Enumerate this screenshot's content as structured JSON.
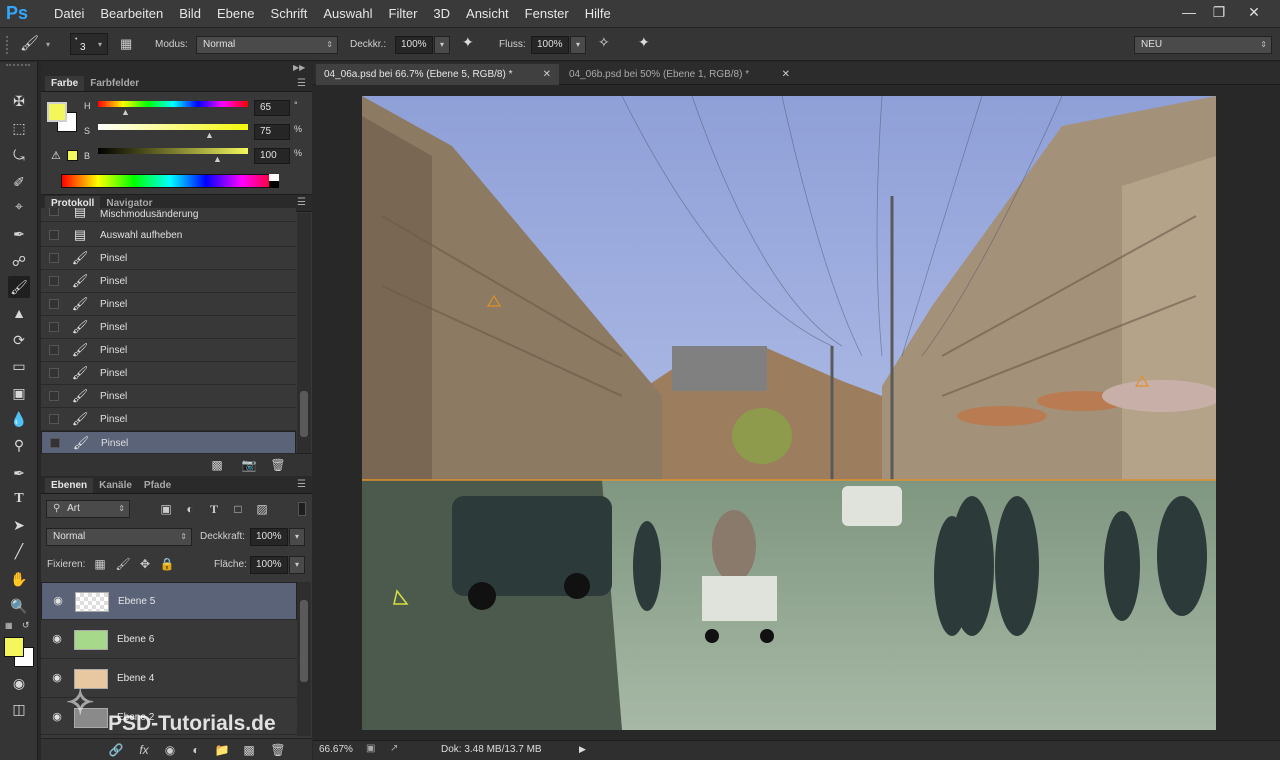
{
  "app": {
    "logo": "Ps"
  },
  "menu": [
    "Datei",
    "Bearbeiten",
    "Bild",
    "Ebene",
    "Schrift",
    "Auswahl",
    "Filter",
    "3D",
    "Ansicht",
    "Fenster",
    "Hilfe"
  ],
  "options": {
    "brush_size": "3",
    "modus_label": "Modus:",
    "modus_value": "Normal",
    "deckkraft_label": "Deckkr.:",
    "deckkraft_value": "100%",
    "fluss_label": "Fluss:",
    "fluss_value": "100%",
    "workspace": "NEU"
  },
  "color_panel": {
    "tabs": [
      "Farbe",
      "Farbfelder"
    ],
    "h_label": "H",
    "h_value": "65",
    "h_unit": "°",
    "s_label": "S",
    "s_value": "75",
    "s_unit": "%",
    "b_label": "B",
    "b_value": "100",
    "b_unit": "%",
    "fg_color": "#f4f75c",
    "bg_color": "#ffffff"
  },
  "history_panel": {
    "tabs": [
      "Protokoll",
      "Navigator"
    ],
    "items": [
      {
        "label": "Mischmodusänderung",
        "icon": "document-icon"
      },
      {
        "label": "Auswahl aufheben",
        "icon": "document-icon"
      },
      {
        "label": "Pinsel",
        "icon": "brush-icon"
      },
      {
        "label": "Pinsel",
        "icon": "brush-icon"
      },
      {
        "label": "Pinsel",
        "icon": "brush-icon"
      },
      {
        "label": "Pinsel",
        "icon": "brush-icon"
      },
      {
        "label": "Pinsel",
        "icon": "brush-icon"
      },
      {
        "label": "Pinsel",
        "icon": "brush-icon"
      },
      {
        "label": "Pinsel",
        "icon": "brush-icon"
      },
      {
        "label": "Pinsel",
        "icon": "brush-icon"
      },
      {
        "label": "Pinsel",
        "icon": "brush-icon"
      }
    ],
    "selected_index": 10
  },
  "layers_panel": {
    "tabs": [
      "Ebenen",
      "Kanäle",
      "Pfade"
    ],
    "filter_value": "Art",
    "blend_mode": "Normal",
    "opacity_label": "Deckkraft:",
    "opacity_value": "100%",
    "lock_label": "Fixieren:",
    "fill_label": "Fläche:",
    "fill_value": "100%",
    "layers": [
      {
        "name": "Ebene 5",
        "thumb": "transparent",
        "selected": true
      },
      {
        "name": "Ebene 6",
        "thumb": "#a6d98a",
        "selected": false
      },
      {
        "name": "Ebene 4",
        "thumb": "#e8c8a0",
        "selected": false
      },
      {
        "name": "Ebene 2",
        "thumb": "#8a8a8a",
        "selected": false
      }
    ]
  },
  "documents": {
    "tabs": [
      "04_06a.psd bei 66.7% (Ebene 5, RGB/8) *",
      "04_06b.psd bei 50% (Ebene 1, RGB/8) *"
    ],
    "active": 0
  },
  "status": {
    "zoom": "66.67%",
    "doc_info": "Dok: 3.48 MB/13.7 MB"
  },
  "watermark": "PSD-Tutorials.de"
}
